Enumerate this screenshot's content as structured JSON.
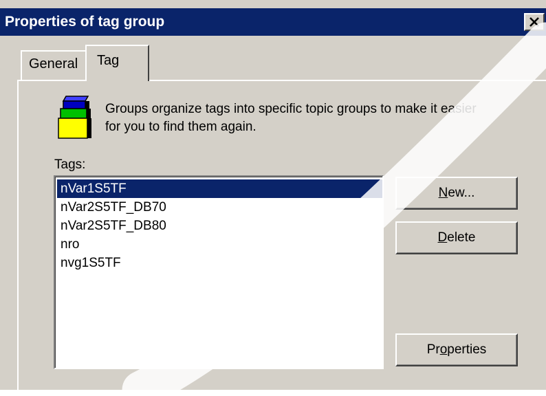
{
  "dialog": {
    "title": "Properties of tag group",
    "close_icon": "close-icon"
  },
  "tabs": [
    {
      "label": "General",
      "active": false
    },
    {
      "label": "Tag",
      "active": true
    }
  ],
  "info": {
    "icon": "tag-group-stack-icon",
    "line1": "Groups organize tags into specific topic groups to make it easier",
    "line2": "for you to find them again."
  },
  "tags_label": "Tags:",
  "tags": [
    {
      "name": "nVar1S5TF",
      "selected": true
    },
    {
      "name": "nVar2S5TF_DB70",
      "selected": false
    },
    {
      "name": "nVar2S5TF_DB80",
      "selected": false
    },
    {
      "name": "nro",
      "selected": false
    },
    {
      "name": "nvg1S5TF",
      "selected": false
    }
  ],
  "buttons": {
    "new": {
      "label_pre": "",
      "label_ul": "N",
      "label_post": "ew..."
    },
    "delete": {
      "label_pre": "",
      "label_ul": "D",
      "label_post": "elete"
    },
    "properties": {
      "label_pre": "Pr",
      "label_ul": "o",
      "label_post": "perties"
    }
  },
  "colors": {
    "titlebar": "#0a246a",
    "selection": "#0a246a",
    "face": "#d4d0c8",
    "icon_blue": "#0000c0",
    "icon_green": "#00c000",
    "icon_yellow": "#ffff00"
  }
}
